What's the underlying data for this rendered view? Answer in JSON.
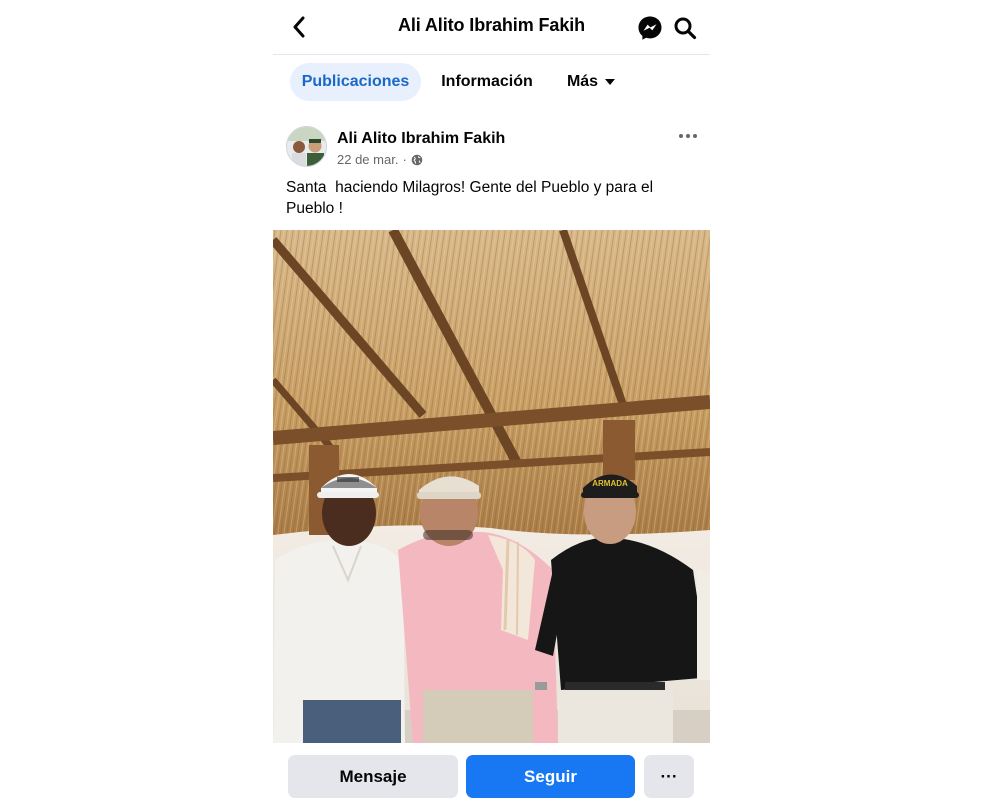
{
  "header": {
    "title": "Ali Alito Ibrahim Fakih",
    "back_icon": "chevron-left-icon",
    "messenger_icon": "messenger-icon",
    "search_icon": "search-icon"
  },
  "tabs": [
    {
      "label": "Publicaciones",
      "active": true
    },
    {
      "label": "Información",
      "active": false
    },
    {
      "label": "Más",
      "active": false
    }
  ],
  "post": {
    "author": "Ali Alito Ibrahim Fakih",
    "date": "22 de mar.",
    "separator": "·",
    "audience_icon": "globe-icon",
    "text": "Santa  haciendo Milagros! Gente del Pueblo y para el\nPueblo !",
    "image": {
      "description_icon": "photo-three-men-under-thatched-roof",
      "cap_text": "ARMADA"
    }
  },
  "actions": {
    "message_label": "Mensaje",
    "follow_label": "Seguir",
    "more_label": "···"
  },
  "colors": {
    "accent": "#1877f2",
    "tab_active_bg": "#e7f0fc",
    "tab_active_text": "#1b68c8",
    "secondary_button_bg": "#e4e6eb",
    "meta_text": "#65676b"
  }
}
